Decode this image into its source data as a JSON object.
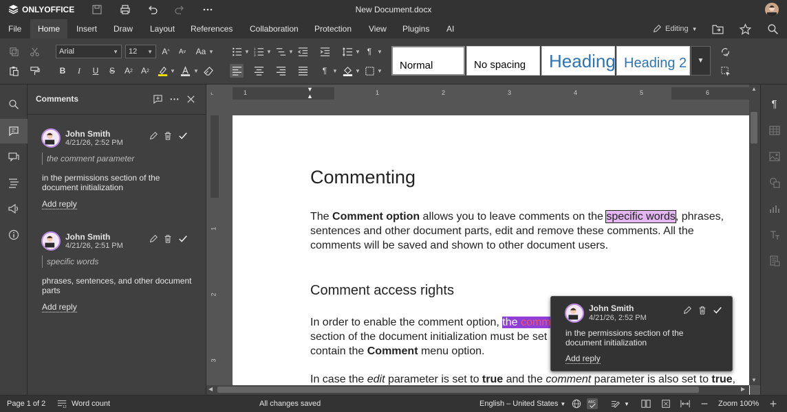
{
  "app": {
    "brand": "ONLYOFFICE",
    "document_title": "New Document.docx"
  },
  "menu": {
    "items": [
      "File",
      "Home",
      "Insert",
      "Draw",
      "Layout",
      "References",
      "Collaboration",
      "Protection",
      "View",
      "Plugins",
      "AI"
    ],
    "active": "Home",
    "editing_label": "Editing"
  },
  "toolbar": {
    "font_name": "Arial",
    "font_size": "12",
    "styles": [
      "Normal",
      "No spacing",
      "Heading 1",
      "Heading 2"
    ]
  },
  "comments_panel": {
    "title": "Comments",
    "comments": [
      {
        "author": "John Smith",
        "date": "4/21/26, 2:52 PM",
        "quote": "the comment parameter",
        "text": "in the permissions section of the document initialization",
        "reply_label": "Add reply"
      },
      {
        "author": "John Smith",
        "date": "4/21/26, 2:51 PM",
        "quote": "specific words",
        "text": "phrases, sentences, and other document parts",
        "reply_label": "Add reply"
      }
    ]
  },
  "document": {
    "heading1": "Commenting",
    "para1": {
      "l1_a": "The ",
      "l1_bold": "Comment option",
      "l1_b": " allows you to leave comments on the ",
      "l1_hl": "specific words",
      "l1_c": ", phrases,",
      "l2": "sentences and other document parts, edit and remove these comments. All the",
      "l3": "comments will be saved and shown to other document users."
    },
    "heading2": "Comment access rights",
    "para2": {
      "l1_a": "In order to enable the comment option, ",
      "l1_hl_a": "the ",
      "l1_hl_b": "comm",
      "l2": "section of the document initialization must be set",
      "l3_a": "contain the ",
      "l3_bold": "Comment",
      "l3_b": " menu option."
    },
    "para3": {
      "a": "In case the ",
      "i1": "edit",
      "b": " parameter is set to ",
      "b1": "true",
      "c": " and the ",
      "i2": "comment",
      "d": " parameter is also set to ",
      "b2": "true",
      "e": ","
    }
  },
  "popup": {
    "author": "John Smith",
    "date": "4/21/26, 2:52 PM",
    "text": "in the permissions section of the document initialization",
    "reply_label": "Add reply"
  },
  "ruler": {
    "numbers": [
      "1",
      "2",
      "3",
      "4",
      "5",
      "6"
    ],
    "vnumbers": [
      "1",
      "2",
      "3"
    ]
  },
  "status": {
    "page": "Page 1 of 2",
    "word_count": "Word count",
    "saved": "All changes saved",
    "language": "English – United States",
    "zoom": "Zoom 100%"
  }
}
